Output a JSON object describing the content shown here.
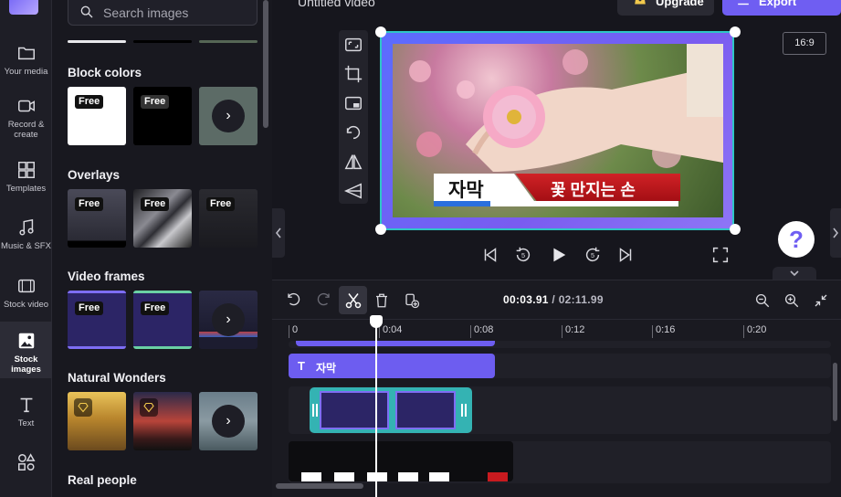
{
  "nav": {
    "items": [
      {
        "label": "Your media",
        "icon": "folder-icon"
      },
      {
        "label": "Record & create",
        "icon": "camera-icon"
      },
      {
        "label": "Templates",
        "icon": "templates-icon"
      },
      {
        "label": "Music & SFX",
        "icon": "music-icon"
      },
      {
        "label": "Stock video",
        "icon": "film-icon"
      },
      {
        "label": "Stock images",
        "icon": "image-icon"
      },
      {
        "label": "Text",
        "icon": "text-icon"
      },
      {
        "label": "",
        "icon": "shapes-icon"
      }
    ],
    "active": "Stock images"
  },
  "panel": {
    "search_placeholder": "Search images",
    "sections": [
      {
        "title": "Block colors",
        "badges": [
          "Free",
          "Free"
        ]
      },
      {
        "title": "Overlays",
        "badges": [
          "Free",
          "Free",
          "Free"
        ]
      },
      {
        "title": "Video frames",
        "badges": [
          "Free",
          "Free"
        ]
      },
      {
        "title": "Natural Wonders",
        "badges": []
      },
      {
        "title": "Real people",
        "badges": []
      }
    ]
  },
  "header": {
    "title": "Untitled video",
    "upgrade_label": "Upgrade",
    "export_label": "Export"
  },
  "preview": {
    "aspect_ratio": "16:9",
    "subtitle_left": "자막",
    "subtitle_right": "꽃 만지는 손",
    "help_label": "?"
  },
  "timeline": {
    "current_time": "00:03.91",
    "total_time": "/ 02:11.99",
    "ticks": [
      "0",
      "0:04",
      "0:08",
      "0:12",
      "0:16",
      "0:20"
    ],
    "text_clip_label": "자막",
    "text_clip_icon": "T"
  },
  "colors": {
    "accent": "#6f5ef2",
    "selection": "#2ec6c6",
    "subtitle_red": "#c81a1f"
  }
}
